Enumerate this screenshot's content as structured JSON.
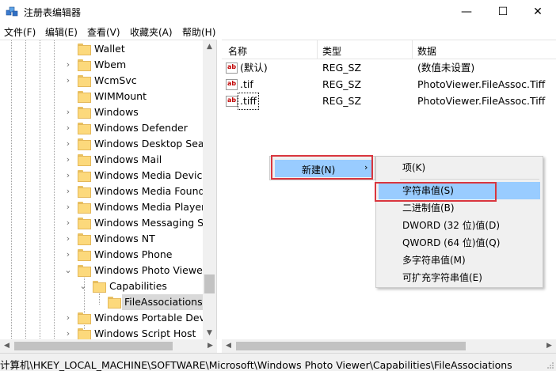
{
  "window": {
    "title": "注册表编辑器",
    "minimize_glyph": "—",
    "maximize_glyph": "☐",
    "close_glyph": "✕"
  },
  "menu": [
    "文件(F)",
    "编辑(E)",
    "查看(V)",
    "收藏夹(A)",
    "帮助(H)"
  ],
  "tree": {
    "items": [
      {
        "label": "Wallet",
        "chevron": ""
      },
      {
        "label": "Wbem",
        "chevron": "›"
      },
      {
        "label": "WcmSvc",
        "chevron": "›"
      },
      {
        "label": "WIMMount",
        "chevron": ""
      },
      {
        "label": "Windows",
        "chevron": "›"
      },
      {
        "label": "Windows Defender",
        "chevron": "›"
      },
      {
        "label": "Windows Desktop Sear",
        "chevron": "›"
      },
      {
        "label": "Windows Mail",
        "chevron": "›"
      },
      {
        "label": "Windows Media Device",
        "chevron": "›"
      },
      {
        "label": "Windows Media Founda",
        "chevron": "›"
      },
      {
        "label": "Windows Media Player",
        "chevron": "›"
      },
      {
        "label": "Windows Messaging Su",
        "chevron": "›"
      },
      {
        "label": "Windows NT",
        "chevron": "›"
      },
      {
        "label": "Windows Phone",
        "chevron": "›"
      },
      {
        "label": "Windows Photo Viewer",
        "chevron": "⌄"
      },
      {
        "label": "Capabilities",
        "chevron": "⌄"
      },
      {
        "label": "FileAssociations",
        "chevron": ""
      },
      {
        "label": "Windows Portable Devic",
        "chevron": "›"
      },
      {
        "label": "Windows Script Host",
        "chevron": "›"
      }
    ]
  },
  "list": {
    "columns": [
      "名称",
      "类型",
      "数据"
    ],
    "rows": [
      {
        "name": "(默认)",
        "type": "REG_SZ",
        "data": "(数值未设置)"
      },
      {
        "name": ".tif",
        "type": "REG_SZ",
        "data": "PhotoViewer.FileAssoc.Tiff"
      },
      {
        "name": ".tiff",
        "type": "REG_SZ",
        "data": "PhotoViewer.FileAssoc.Tiff"
      }
    ],
    "value_icon_text": "ab"
  },
  "context_menu": {
    "new_label": "新建(N)",
    "new_arrow": "›"
  },
  "submenu": {
    "items": [
      "项(K)",
      "字符串值(S)",
      "二进制值(B)",
      "DWORD (32 位)值(D)",
      "QWORD (64 位)值(Q)",
      "多字符串值(M)",
      "可扩充字符串值(E)"
    ]
  },
  "statusbar": {
    "path": "计算机\\HKEY_LOCAL_MACHINE\\SOFTWARE\\Microsoft\\Windows Photo Viewer\\Capabilities\\FileAssociations"
  },
  "colors": {
    "highlight": "#99ccff",
    "annotation_red": "#d9363e"
  }
}
